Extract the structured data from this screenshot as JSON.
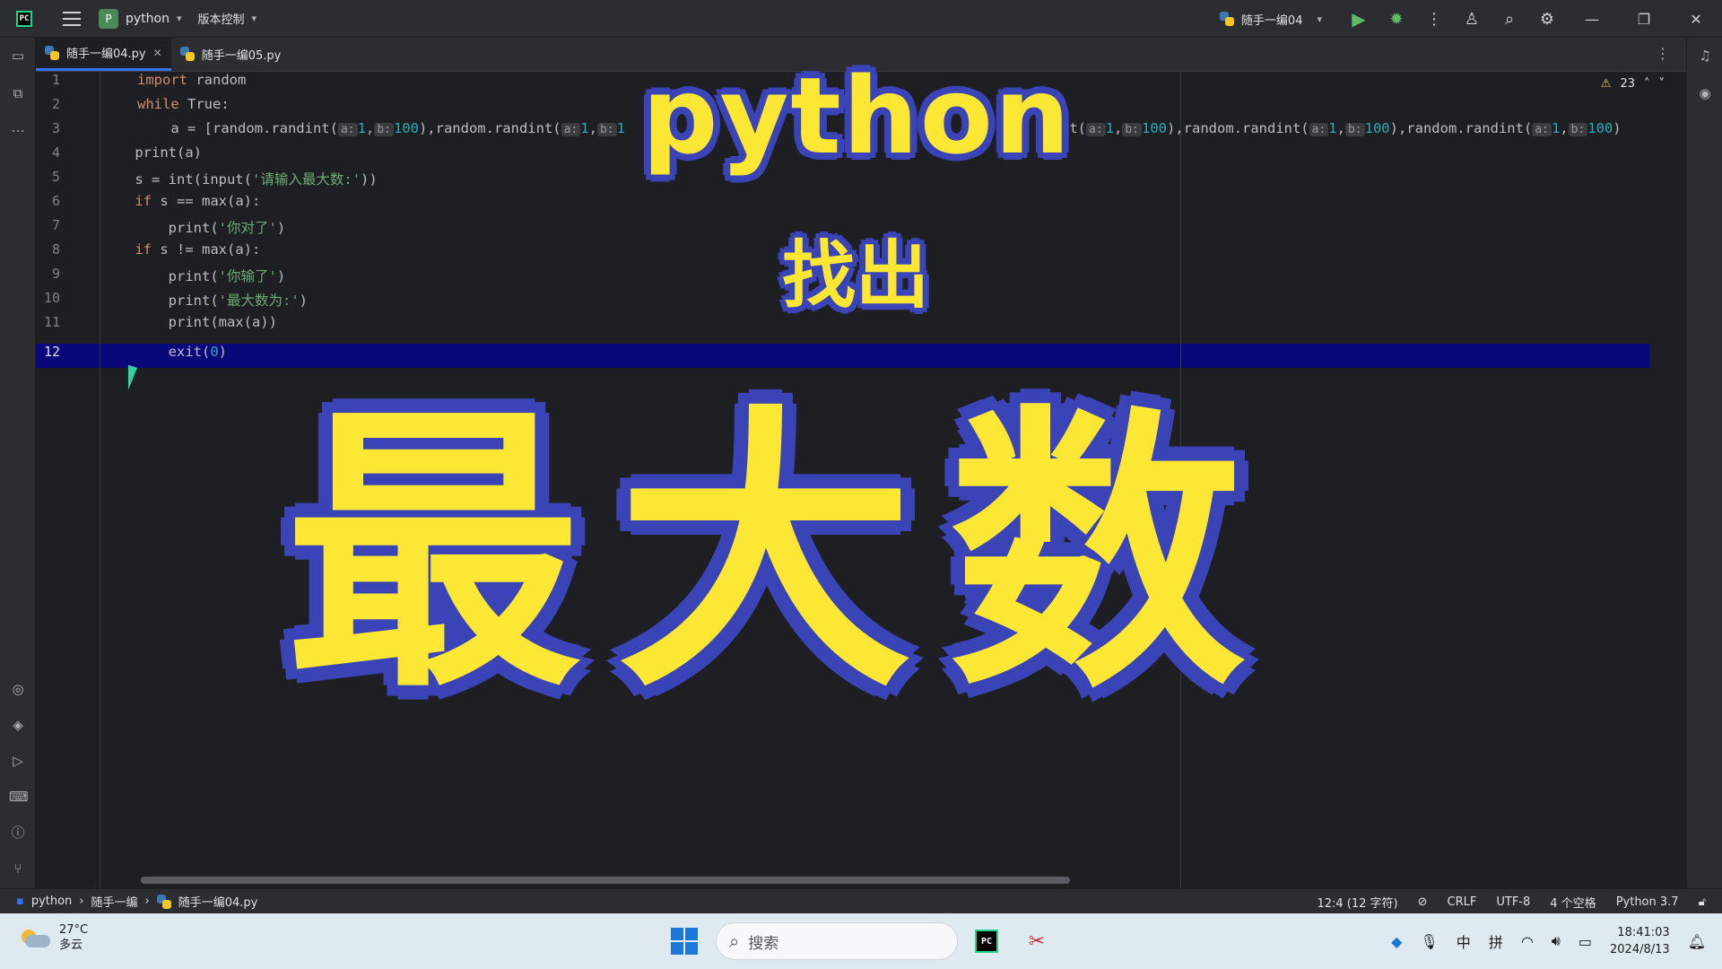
{
  "titlebar": {
    "project_badge": "P",
    "project_name": "python",
    "vcs_label": "版本控制",
    "run_config": "随手一编04"
  },
  "tabs": [
    {
      "label": "随手一编04.py",
      "active": true
    },
    {
      "label": "随手一编05.py",
      "active": false
    }
  ],
  "editor": {
    "line_numbers": [
      "1",
      "2",
      "3",
      "4",
      "5",
      "6",
      "7",
      "8",
      "9",
      "10",
      "11",
      "12"
    ],
    "current_line": "12",
    "warning_count": "23",
    "lines": {
      "l1_kw": "import",
      "l1_rest": " random",
      "l2_kw": "while",
      "l2_rest": " True:",
      "l3_a": "    a = [random.randint(",
      "l3_h1": "a:",
      "l3_v1": "1",
      "l3_h2": "b:",
      "l3_v2": "100",
      "l3_b": "),random.randint(",
      "l3_h3": "a:",
      "l3_v3": "1",
      "l3_h4": "b:",
      "l3_v4": "1",
      "l3_tail_a": "nt(",
      "l3_th1": "a:",
      "l3_tv1": "1",
      "l3_th2": "b:",
      "l3_tv2": "100",
      "l3_tail_b": "),random.randint(",
      "l3_th3": "a:",
      "l3_tv3": "1",
      "l3_th4": "b:",
      "l3_tv4": "100",
      "l3_tail_c": "),random.randint(",
      "l3_th5": "a:",
      "l3_tv5": "1",
      "l3_th6": "b:",
      "l3_tv6": "100",
      "l3_tail_d": ")",
      "l4": "    print(a)",
      "l5_a": "    s = int(input(",
      "l5_str": "'请输入最大数:'",
      "l5_b": "))",
      "l6_kw": "    if",
      "l6_rest": " s == max(a):",
      "l7_a": "        print(",
      "l7_str": "'你对了'",
      "l7_b": ")",
      "l8_kw": "    if",
      "l8_rest": " s != max(a):",
      "l9_a": "        print(",
      "l9_str": "'你输了'",
      "l9_b": ")",
      "l10_a": "        print(",
      "l10_str": "'最大数为:'",
      "l10_b": ")",
      "l11": "        print(max(a))",
      "l12_a": "        exit(",
      "l12_num": "0",
      "l12_b": ")"
    }
  },
  "overlay": {
    "python": "python",
    "find": "找出",
    "max_number": "最大数"
  },
  "statusbar": {
    "breadcrumb": [
      "python",
      "随手一编",
      "随手一编04.py"
    ],
    "position": "12:4 (12 字符)",
    "line_ending": "CRLF",
    "encoding": "UTF-8",
    "indent": "4 个空格",
    "interpreter": "Python 3.7"
  },
  "taskbar": {
    "temperature": "27°C",
    "weather": "多云",
    "search_placeholder": "搜索",
    "ime_lang": "中",
    "ime_mode": "拼",
    "time": "18:41:03",
    "date": "2024/8/13"
  },
  "colors": {
    "accent": "#3574f0",
    "overlay_fill": "#fce834",
    "overlay_stroke": "#3a44b6",
    "current_line": "#08087a"
  }
}
